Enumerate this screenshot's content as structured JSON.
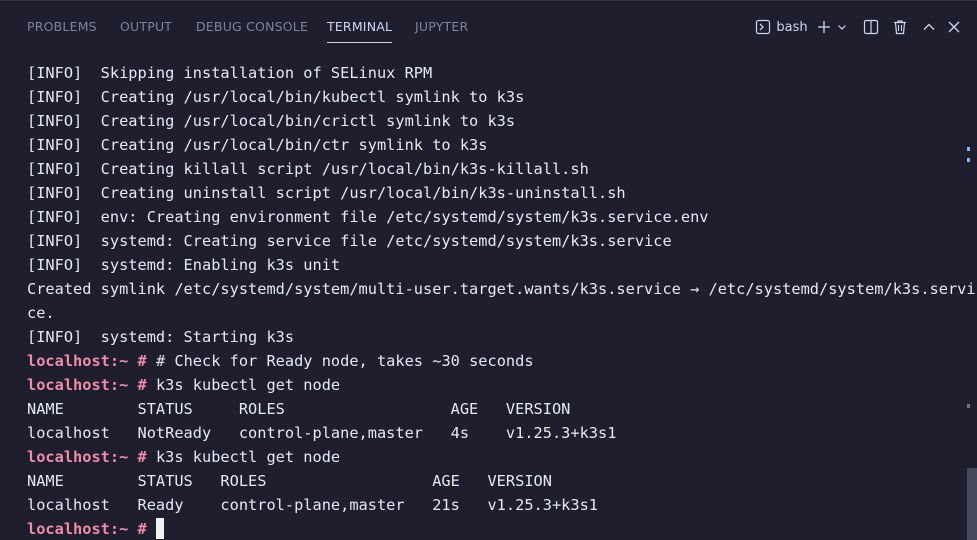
{
  "panel": {
    "tabs": [
      {
        "label": "PROBLEMS",
        "active": false
      },
      {
        "label": "OUTPUT",
        "active": false
      },
      {
        "label": "DEBUG CONSOLE",
        "active": false
      },
      {
        "label": "TERMINAL",
        "active": true
      },
      {
        "label": "JUPYTER",
        "active": false
      }
    ],
    "toolbar": {
      "shell_label": "bash",
      "icons": [
        "terminal-icon",
        "plus-icon",
        "chevron-down-icon",
        "split-icon",
        "trash-icon",
        "chevron-up-icon",
        "close-icon"
      ]
    }
  },
  "terminal": {
    "lines": [
      {
        "text": "[INFO]  Skipping installation of SELinux RPM"
      },
      {
        "text": "[INFO]  Creating /usr/local/bin/kubectl symlink to k3s"
      },
      {
        "text": "[INFO]  Creating /usr/local/bin/crictl symlink to k3s"
      },
      {
        "text": "[INFO]  Creating /usr/local/bin/ctr symlink to k3s"
      },
      {
        "text": "[INFO]  Creating killall script /usr/local/bin/k3s-killall.sh"
      },
      {
        "text": "[INFO]  Creating uninstall script /usr/local/bin/k3s-uninstall.sh"
      },
      {
        "text": "[INFO]  env: Creating environment file /etc/systemd/system/k3s.service.env"
      },
      {
        "text": "[INFO]  systemd: Creating service file /etc/systemd/system/k3s.service"
      },
      {
        "text": "[INFO]  systemd: Enabling k3s unit"
      },
      {
        "text": "Created symlink /etc/systemd/system/multi-user.target.wants/k3s.service → /etc/systemd/system/k3s.servi"
      },
      {
        "text": "ce."
      },
      {
        "text": "[INFO]  systemd: Starting k3s"
      },
      {
        "prompt": "localhost:~ #",
        "text": " # Check for Ready node, takes ~30 seconds"
      },
      {
        "prompt": "localhost:~ #",
        "text": " k3s kubectl get node"
      },
      {
        "text": "NAME        STATUS     ROLES                  AGE   VERSION"
      },
      {
        "text": "localhost   NotReady   control-plane,master   4s    v1.25.3+k3s1"
      },
      {
        "prompt": "localhost:~ #",
        "text": " k3s kubectl get node"
      },
      {
        "text": "NAME        STATUS   ROLES                  AGE   VERSION"
      },
      {
        "text": "localhost   Ready    control-plane,master   21s   v1.25.3+k3s1"
      },
      {
        "prompt": "localhost:~ #",
        "text": " ",
        "cursor": true
      }
    ]
  },
  "colors": {
    "background": "#1e1e2e",
    "prompt": "#f38ba8",
    "text": "#e6e9f0",
    "tab_inactive": "#7f849c",
    "tab_active": "#cdd6f4"
  }
}
